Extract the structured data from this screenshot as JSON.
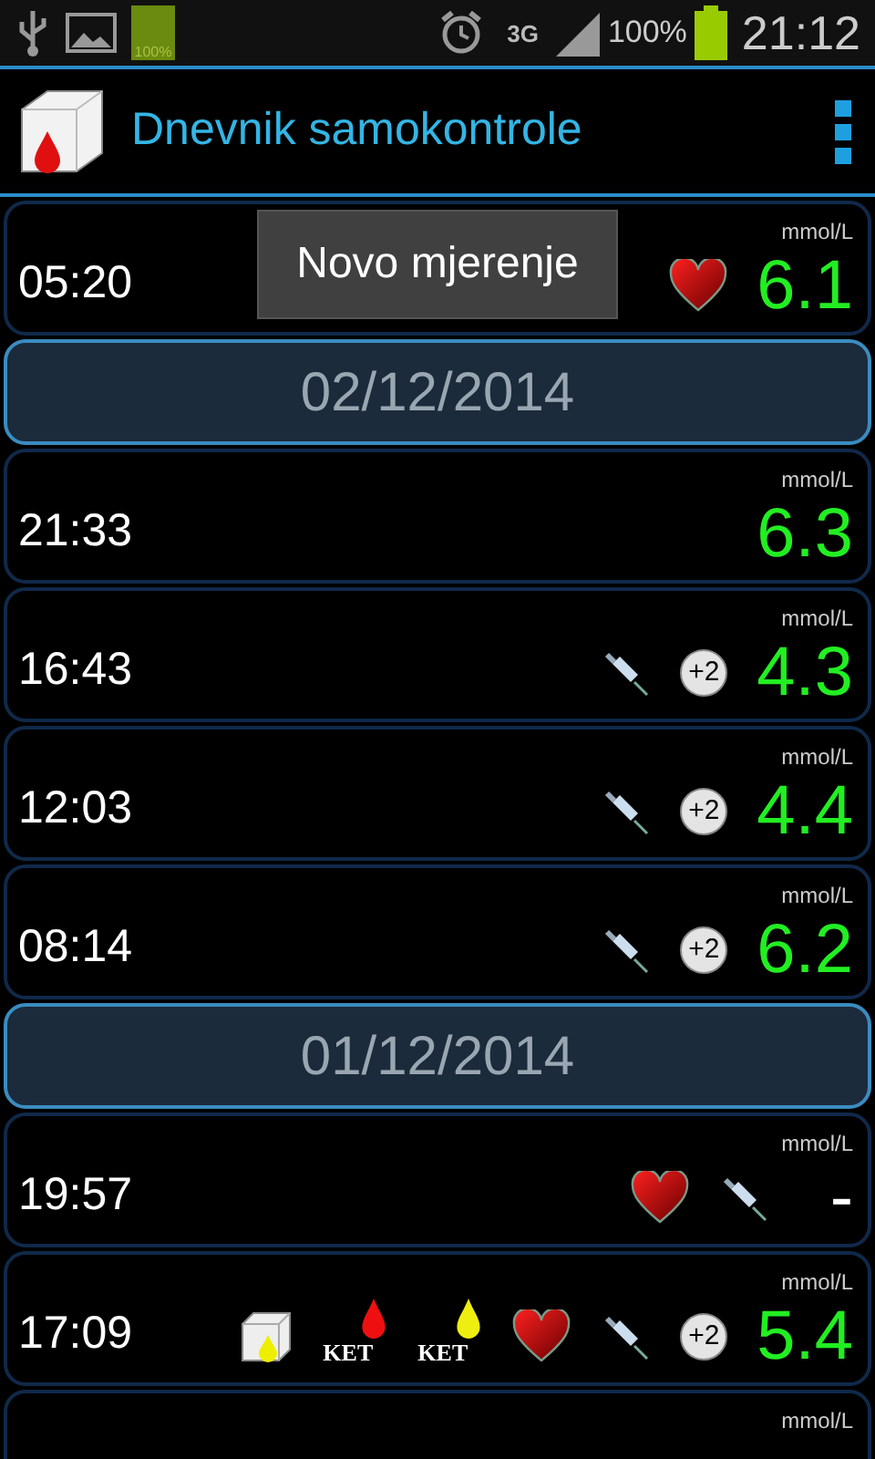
{
  "status_bar": {
    "battery_small_label": "100%",
    "network": "3G",
    "battery_percent": "100%",
    "time": "21:12"
  },
  "app_bar": {
    "title": "Dnevnik samokontrole"
  },
  "tooltip": {
    "text": "Novo mjerenje"
  },
  "list": [
    {
      "kind": "reading",
      "time": "05:20",
      "unit": "mmol/L",
      "value": "6.1",
      "missing": false,
      "icons": [
        {
          "kind": "heart"
        }
      ]
    },
    {
      "kind": "date",
      "text": "02/12/2014"
    },
    {
      "kind": "reading",
      "time": "21:33",
      "unit": "mmol/L",
      "value": "6.3",
      "missing": false
    },
    {
      "kind": "reading",
      "time": "16:43",
      "unit": "mmol/L",
      "value": "4.3",
      "missing": false,
      "icons": [
        {
          "kind": "syringe"
        },
        {
          "kind": "badge",
          "label": "+2"
        }
      ]
    },
    {
      "kind": "reading",
      "time": "12:03",
      "unit": "mmol/L",
      "value": "4.4",
      "missing": false,
      "icons": [
        {
          "kind": "syringe"
        },
        {
          "kind": "badge",
          "label": "+2"
        }
      ]
    },
    {
      "kind": "reading",
      "time": "08:14",
      "unit": "mmol/L",
      "value": "6.2",
      "missing": false,
      "icons": [
        {
          "kind": "syringe"
        },
        {
          "kind": "badge",
          "label": "+2"
        }
      ]
    },
    {
      "kind": "date",
      "text": "01/12/2014"
    },
    {
      "kind": "reading",
      "time": "19:57",
      "unit": "mmol/L",
      "value": "-",
      "missing": true,
      "icons": [
        {
          "kind": "heart"
        },
        {
          "kind": "syringe"
        }
      ]
    },
    {
      "kind": "reading",
      "time": "17:09",
      "unit": "mmol/L",
      "value": "5.4",
      "missing": false,
      "icons": [
        {
          "kind": "urine_cube"
        },
        {
          "kind": "ketone_blood",
          "label": "KET"
        },
        {
          "kind": "ketone_urine",
          "label": "KET"
        },
        {
          "kind": "heart"
        },
        {
          "kind": "syringe"
        },
        {
          "kind": "badge",
          "label": "+2"
        }
      ]
    },
    {
      "kind": "partial",
      "unit": "mmol/L"
    }
  ]
}
